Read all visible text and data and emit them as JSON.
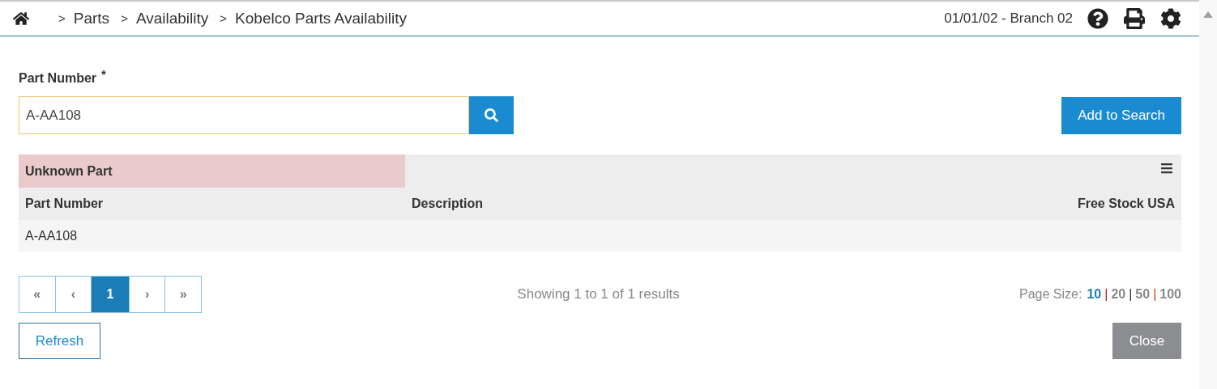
{
  "breadcrumb": {
    "separator": ">",
    "items": [
      "Parts",
      "Availability",
      "Kobelco Parts Availability"
    ]
  },
  "context": "01/01/02 - Branch 02",
  "part_number_field": {
    "label": "Part Number",
    "required_mark": "*",
    "value": "A-AA108"
  },
  "add_button": "Add to Search",
  "result_group": {
    "title": "Unknown Part"
  },
  "table": {
    "columns": [
      "Part Number",
      "Description",
      "Free Stock USA"
    ],
    "rows": [
      [
        "A-AA108",
        "",
        ""
      ]
    ]
  },
  "pagination": [
    {
      "label": "«",
      "selected": false
    },
    {
      "label": "‹",
      "selected": false
    },
    {
      "label": "1",
      "selected": true
    },
    {
      "label": "›",
      "selected": false
    },
    {
      "label": "»",
      "selected": false
    }
  ],
  "summary": "Showing 1 to 1 of 1 results",
  "page_size": {
    "label": "Page Size:",
    "separator": "|",
    "options": [
      {
        "label": "10",
        "selected": true
      },
      {
        "label": "20",
        "selected": false
      },
      {
        "label": "50",
        "selected": false
      },
      {
        "label": "100",
        "selected": false
      }
    ]
  },
  "refresh_button": "Refresh",
  "close_button": "Close"
}
